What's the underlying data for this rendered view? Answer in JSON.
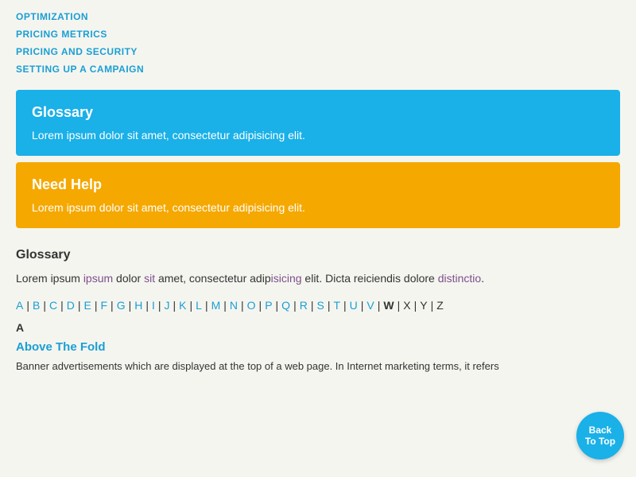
{
  "nav": {
    "links": [
      {
        "label": "OPTIMIZATION",
        "href": "#"
      },
      {
        "label": "PRICING METRICS",
        "href": "#"
      },
      {
        "label": "PRICING AND SECURITY",
        "href": "#"
      },
      {
        "label": "SETTING UP A CAMPAIGN",
        "href": "#"
      }
    ]
  },
  "cards": [
    {
      "id": "glossary-card",
      "type": "blue",
      "title": "Glossary",
      "text": "Lorem ipsum dolor sit amet, consectetur adipisicing elit."
    },
    {
      "id": "need-help-card",
      "type": "yellow",
      "title": "Need Help",
      "text": "Lorem ipsum dolor sit amet, consectetur adipisicing elit."
    }
  ],
  "glossary": {
    "title": "Glossary",
    "description": "Lorem ipsum dolor sit amet, consectetur adipisicing elit. Dicta reiciendis dolore distinctio.",
    "alphabet": [
      "A",
      "B",
      "C",
      "D",
      "E",
      "F",
      "G",
      "H",
      "I",
      "J",
      "K",
      "L",
      "M",
      "N",
      "O",
      "P",
      "Q",
      "R",
      "S",
      "T",
      "U",
      "V",
      "W",
      "X",
      "Y",
      "Z"
    ],
    "current_letter": "A",
    "terms": [
      {
        "term": "Above The Fold",
        "definition": "Banner advertisements which are displayed at the top of a web page. In Internet marketing terms, it refers"
      }
    ]
  },
  "back_to_top": {
    "line1": "Back",
    "line2": "To Top"
  }
}
